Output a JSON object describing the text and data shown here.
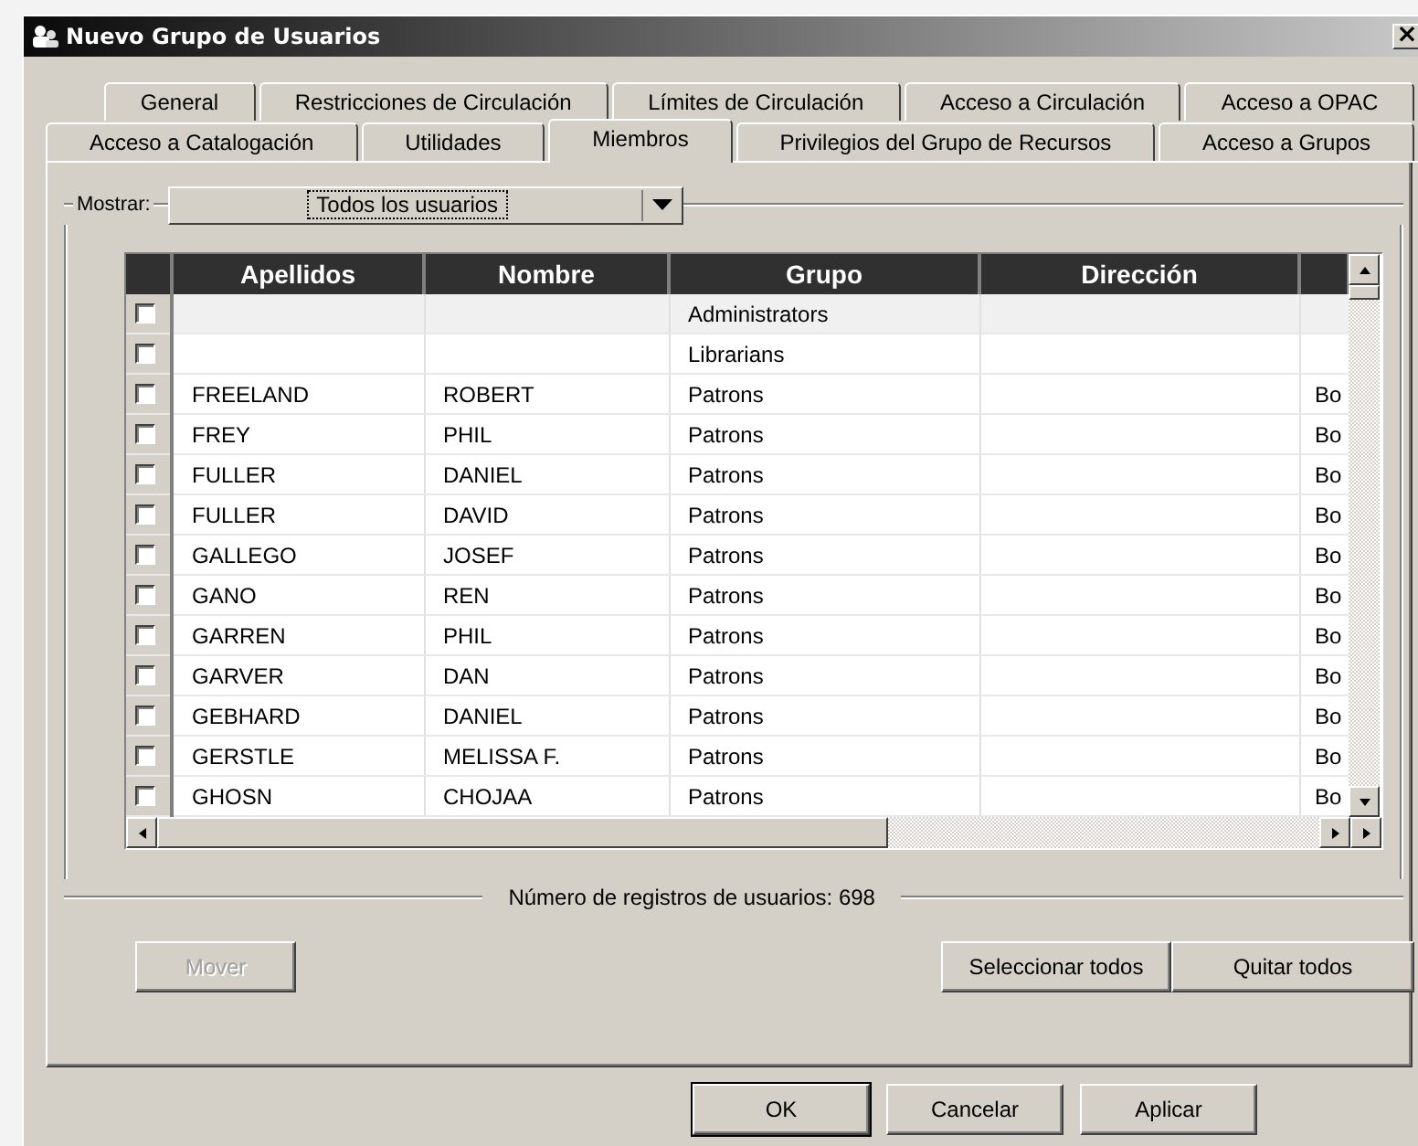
{
  "window": {
    "title": "Nuevo Grupo de Usuarios",
    "close_button": "×"
  },
  "tab_rows": [
    [
      {
        "label": "General",
        "selected": false
      },
      {
        "label": "Restricciones de Circulación",
        "selected": false
      },
      {
        "label": "Límites de Circulación",
        "selected": false
      },
      {
        "label": "Acceso a Circulación",
        "selected": false
      },
      {
        "label": "Acceso a OPAC",
        "selected": false
      }
    ],
    [
      {
        "label": "Acceso a Catalogación",
        "selected": false
      },
      {
        "label": "Utilidades",
        "selected": false
      },
      {
        "label": "Miembros",
        "selected": true
      },
      {
        "label": "Privilegios del Grupo de Recursos",
        "selected": false
      },
      {
        "label": "Acceso a Grupos",
        "selected": false
      }
    ]
  ],
  "filter": {
    "label": "Mostrar:",
    "value": "Todos los usuarios"
  },
  "table": {
    "columns": [
      "Apellidos",
      "Nombre",
      "Grupo",
      "Dirección"
    ],
    "rows": [
      {
        "checked": false,
        "selected": true,
        "grupo": "Administrators"
      },
      {
        "checked": false,
        "selected": false,
        "grupo": "Librarians"
      },
      {
        "checked": false,
        "selected": false,
        "apellidos": "FREELAND",
        "nombre": "ROBERT",
        "grupo": "Patrons",
        "column_5": "Bo"
      },
      {
        "checked": false,
        "selected": false,
        "apellidos": "FREY",
        "nombre": "PHIL",
        "grupo": "Patrons",
        "column_5": "Bo"
      },
      {
        "checked": false,
        "selected": false,
        "apellidos": "FULLER",
        "nombre": "DANIEL",
        "grupo": "Patrons",
        "column_5": "Bo"
      },
      {
        "checked": false,
        "selected": false,
        "apellidos": "FULLER",
        "nombre": "DAVID",
        "grupo": "Patrons",
        "column_5": "Bo"
      },
      {
        "checked": false,
        "selected": false,
        "apellidos": "GALLEGO",
        "nombre": "JOSEF",
        "grupo": "Patrons",
        "column_5": "Bo"
      },
      {
        "checked": false,
        "selected": false,
        "apellidos": "GANO",
        "nombre": "REN",
        "grupo": "Patrons",
        "column_5": "Bo"
      },
      {
        "checked": false,
        "selected": false,
        "apellidos": "GARREN",
        "nombre": "PHIL",
        "grupo": "Patrons",
        "column_5": "Bo"
      },
      {
        "checked": false,
        "selected": false,
        "apellidos": "GARVER",
        "nombre": "DAN",
        "grupo": "Patrons",
        "column_5": "Bo"
      },
      {
        "checked": false,
        "selected": false,
        "apellidos": "GEBHARD",
        "nombre": "DANIEL",
        "grupo": "Patrons",
        "column_5": "Bo"
      },
      {
        "checked": false,
        "selected": false,
        "apellidos": "GERSTLE",
        "nombre": "MELISSA F.",
        "grupo": "Patrons",
        "column_5": "Bo"
      },
      {
        "checked": false,
        "selected": false,
        "apellidos": "GHOSN",
        "nombre": "CHOJAA",
        "grupo": "Patrons",
        "column_5": "Bo"
      }
    ]
  },
  "record_count": "Número de registros de usuarios: 698",
  "panel_buttons": [
    {
      "label": "Mover",
      "disabled": true
    },
    {
      "label": "Seleccionar todos",
      "disabled": false
    },
    {
      "label": "Quitar todos",
      "disabled": false
    }
  ],
  "dialog_buttons": [
    {
      "label": "OK",
      "default": true
    },
    {
      "label": "Cancelar",
      "default": false
    },
    {
      "label": "Aplicar",
      "default": false
    }
  ]
}
